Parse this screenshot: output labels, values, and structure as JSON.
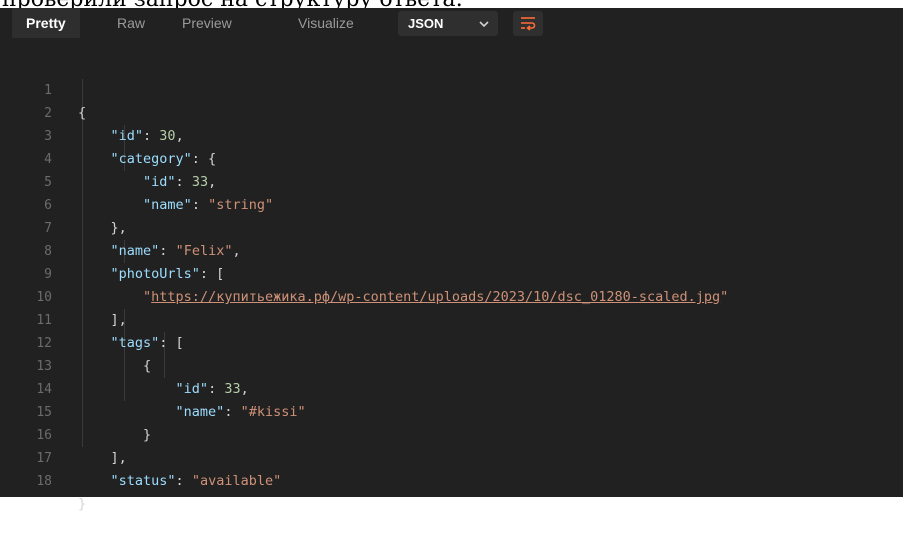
{
  "caption": "проверили запрос на структуру ответа:",
  "tabs": [
    {
      "label": "Pretty",
      "active": true
    },
    {
      "label": "Raw",
      "active": false
    },
    {
      "label": "Preview",
      "active": false
    },
    {
      "label": "Visualize",
      "active": false
    }
  ],
  "format_select": {
    "value": "JSON",
    "icon": "chevron-down-icon"
  },
  "wrap_button": {
    "icon": "wrap-lines-icon"
  },
  "code": {
    "line_numbers": [
      "1",
      "2",
      "3",
      "4",
      "5",
      "6",
      "7",
      "8",
      "9",
      "10",
      "11",
      "12",
      "13",
      "14",
      "15",
      "16",
      "17",
      "18"
    ],
    "tokens": {
      "id_key": "\"id\"",
      "id_val": "30",
      "category_key": "\"category\"",
      "cat_id_key": "\"id\"",
      "cat_id_val": "33",
      "cat_name_key": "\"name\"",
      "cat_name_val": "\"string\"",
      "name_key": "\"name\"",
      "name_val": "\"Felix\"",
      "photo_key": "\"photoUrls\"",
      "photo_url": "https://купитьежика.рф/wp-content/uploads/2023/10/dsc_01280-scaled.jpg",
      "tags_key": "\"tags\"",
      "tag_id_key": "\"id\"",
      "tag_id_val": "33",
      "tag_name_key": "\"name\"",
      "tag_name_val": "\"#kissi\"",
      "status_key": "\"status\"",
      "status_val": "\"available\""
    }
  },
  "colors": {
    "background": "#212121",
    "key": "#9cdcfe",
    "string": "#ce9178",
    "number": "#b5cea8",
    "punctuation": "#d4d4d4",
    "line_number": "#6b6b6b",
    "accent": "#ff6c37"
  }
}
